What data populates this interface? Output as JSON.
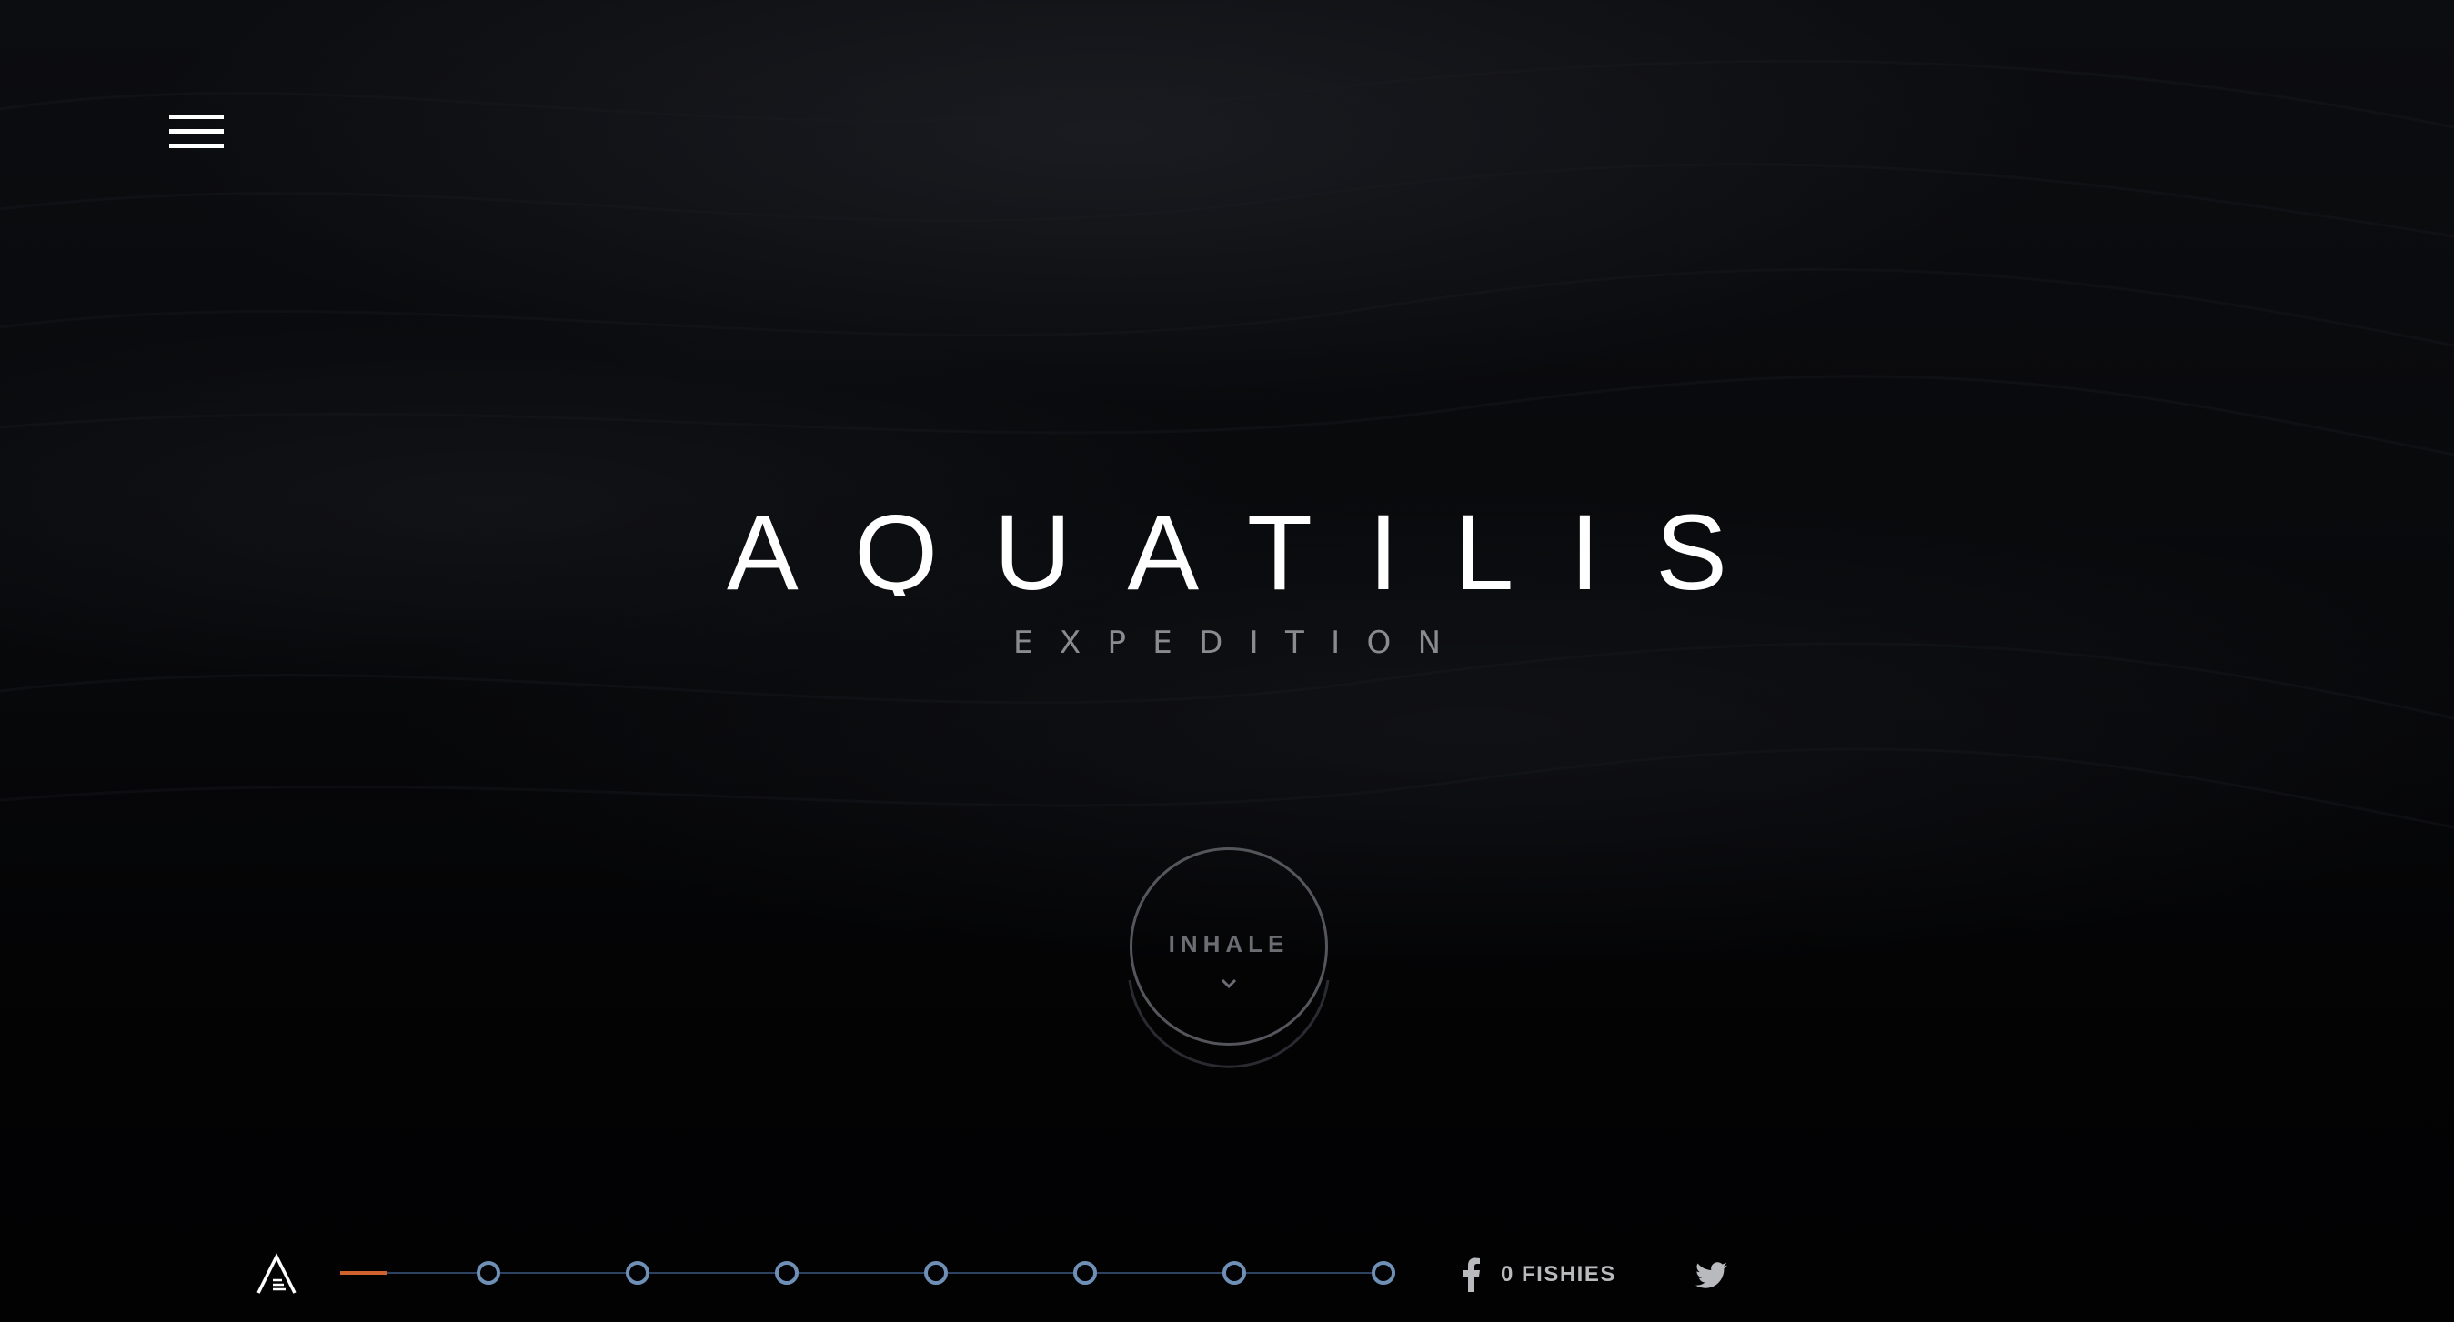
{
  "page": {
    "title": "AQUATILIS",
    "subtitle": "EXPEDITION"
  },
  "menu": {
    "icon": "hamburger-menu-icon"
  },
  "inhale_button": {
    "label": "INHALE",
    "icon": "chevron-down-icon"
  },
  "footer": {
    "logo_icon": "aquatilis-a-logo-icon",
    "timeline": {
      "progress_fraction": 0.045,
      "node_count": 7,
      "track_color": "#2c4260",
      "node_color": "#6e8fb6",
      "progress_color": "#d0622e"
    },
    "facebook": {
      "icon": "facebook-icon",
      "label": "0 FISHIES"
    },
    "twitter": {
      "icon": "twitter-icon"
    }
  },
  "colors": {
    "background": "#050507",
    "title": "#ffffff",
    "subtitle": "#8a8b90",
    "inhale_text": "#6c6d73"
  }
}
